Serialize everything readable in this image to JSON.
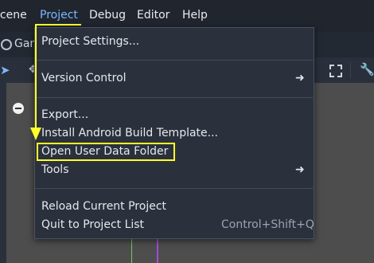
{
  "menubar": {
    "items": [
      {
        "label": "Scene",
        "active": false
      },
      {
        "label": "Project",
        "active": true
      },
      {
        "label": "Debug",
        "active": false
      },
      {
        "label": "Editor",
        "active": false
      },
      {
        "label": "Help",
        "active": false
      }
    ]
  },
  "tabbar": {
    "tab_label": "Gam"
  },
  "dropdown": {
    "items": [
      {
        "label": "Project Settings..."
      },
      {
        "label": "Version Control",
        "submenu": true
      },
      {
        "label": "Export..."
      },
      {
        "label": "Install Android Build Template..."
      },
      {
        "label": "Open User Data Folder",
        "highlighted": true
      },
      {
        "label": "Tools",
        "submenu": true
      },
      {
        "label": "Reload Current Project"
      },
      {
        "label": "Quit to Project List",
        "shortcut": "Control+Shift+Q"
      }
    ],
    "arrow_glyph": "➜"
  },
  "annotation": {
    "color": "#ffff2a"
  },
  "colors": {
    "accent": "#7ab8ff",
    "menu_bg": "#2b313c",
    "viewport": "#4d4d4d"
  }
}
